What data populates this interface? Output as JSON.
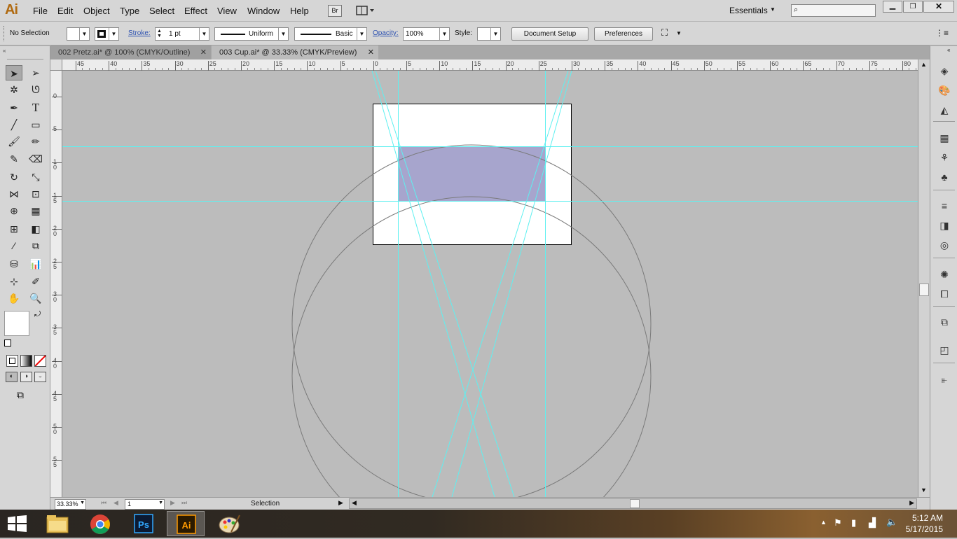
{
  "app": {
    "logo": "Ai",
    "menus": [
      "File",
      "Edit",
      "Object",
      "Type",
      "Select",
      "Effect",
      "View",
      "Window",
      "Help"
    ],
    "bridge_label": "Br",
    "workspace": "Essentials",
    "search_placeholder": ""
  },
  "control": {
    "selection": "No Selection",
    "stroke_label": "Stroke:",
    "stroke_weight": "1 pt",
    "profile": "Uniform",
    "brush": "Basic",
    "opacity_label": "Opacity:",
    "opacity": "100%",
    "style_label": "Style:",
    "doc_setup": "Document Setup",
    "preferences": "Preferences"
  },
  "tabs": [
    {
      "label": "002 Pretz.ai* @ 100% (CMYK/Outline)",
      "active": false
    },
    {
      "label": "003 Cup.ai* @ 33.33% (CMYK/Preview)",
      "active": true
    }
  ],
  "ruler_top": [
    "45",
    "40",
    "35",
    "30",
    "25",
    "20",
    "15",
    "10",
    "5",
    "0",
    "5",
    "10",
    "15",
    "20",
    "25",
    "30",
    "35",
    "40",
    "45",
    "50",
    "55",
    "60",
    "65",
    "70",
    "75",
    "80"
  ],
  "ruler_left": [
    "0",
    "5",
    "10",
    "15",
    "20",
    "25",
    "30",
    "35",
    "40",
    "45",
    "50",
    "55"
  ],
  "status": {
    "zoom": "33.33%",
    "page": "1",
    "tool": "Selection"
  },
  "taskbar": {
    "time": "5:12 AM",
    "date": "5/17/2015",
    "apps": [
      "File Explorer",
      "Chrome",
      "Photoshop",
      "Illustrator",
      "Paint"
    ]
  },
  "colors": {
    "guide": "#5ef0f0",
    "fill": "#a7a5cd",
    "accent": "#b06a10"
  }
}
